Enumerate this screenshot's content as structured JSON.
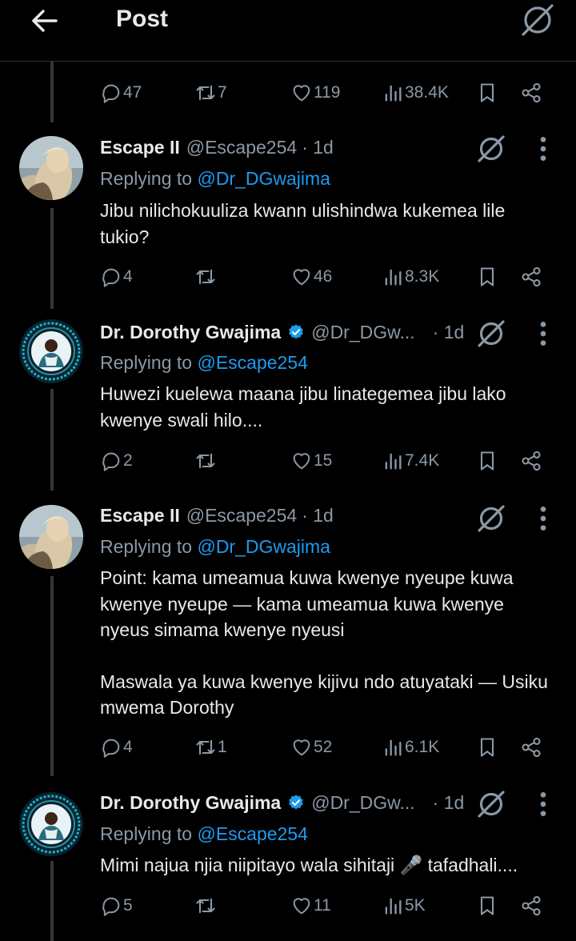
{
  "header": {
    "title": "Post"
  },
  "top_actions": {
    "replies": "47",
    "reposts": "7",
    "likes": "119",
    "views": "38.4K"
  },
  "tweets": [
    {
      "name": "Escape II",
      "handle": "@Escape254",
      "time": "· 1d",
      "verified": false,
      "reply_prefix": "Replying to",
      "reply_to": "@Dr_DGwajima",
      "text": [
        "Jibu nilichokuuliza kwann ulishindwa kukemea lile tukio?"
      ],
      "replies": "4",
      "reposts": "",
      "likes": "46",
      "views": "8.3K"
    },
    {
      "name": "Dr. Dorothy Gwajima",
      "handle": "@Dr_DGw...",
      "time": "· 1d",
      "verified": true,
      "reply_prefix": "Replying to",
      "reply_to": "@Escape254",
      "text": [
        "Huwezi kuelewa maana jibu linategemea jibu lako kwenye swali hilo...."
      ],
      "replies": "2",
      "reposts": "",
      "likes": "15",
      "views": "7.4K"
    },
    {
      "name": "Escape II",
      "handle": "@Escape254",
      "time": "· 1d",
      "verified": false,
      "reply_prefix": "Replying to",
      "reply_to": "@Dr_DGwajima",
      "text": [
        "Point: kama umeamua kuwa kwenye nyeupe kuwa kwenye nyeupe — kama umeamua kuwa kwenye nyeus simama kwenye nyeusi",
        "Maswala ya kuwa kwenye kijivu ndo atuyataki — Usiku mwema Dorothy"
      ],
      "replies": "4",
      "reposts": "1",
      "likes": "52",
      "views": "6.1K"
    },
    {
      "name": "Dr. Dorothy Gwajima",
      "handle": "@Dr_DGw...",
      "time": "· 1d",
      "verified": true,
      "reply_prefix": "Replying to",
      "reply_to": "@Escape254",
      "text": [
        "Mimi najua njia niipitayo wala sihitaji 🎤 tafadhali...."
      ],
      "replies": "5",
      "reposts": "",
      "likes": "11",
      "views": "5K"
    }
  ],
  "colors": {
    "background": "#000000",
    "text": "#e7e9ea",
    "muted": "#8b98a5",
    "link": "#1d9bf0",
    "verified": "#1d9bf0"
  }
}
